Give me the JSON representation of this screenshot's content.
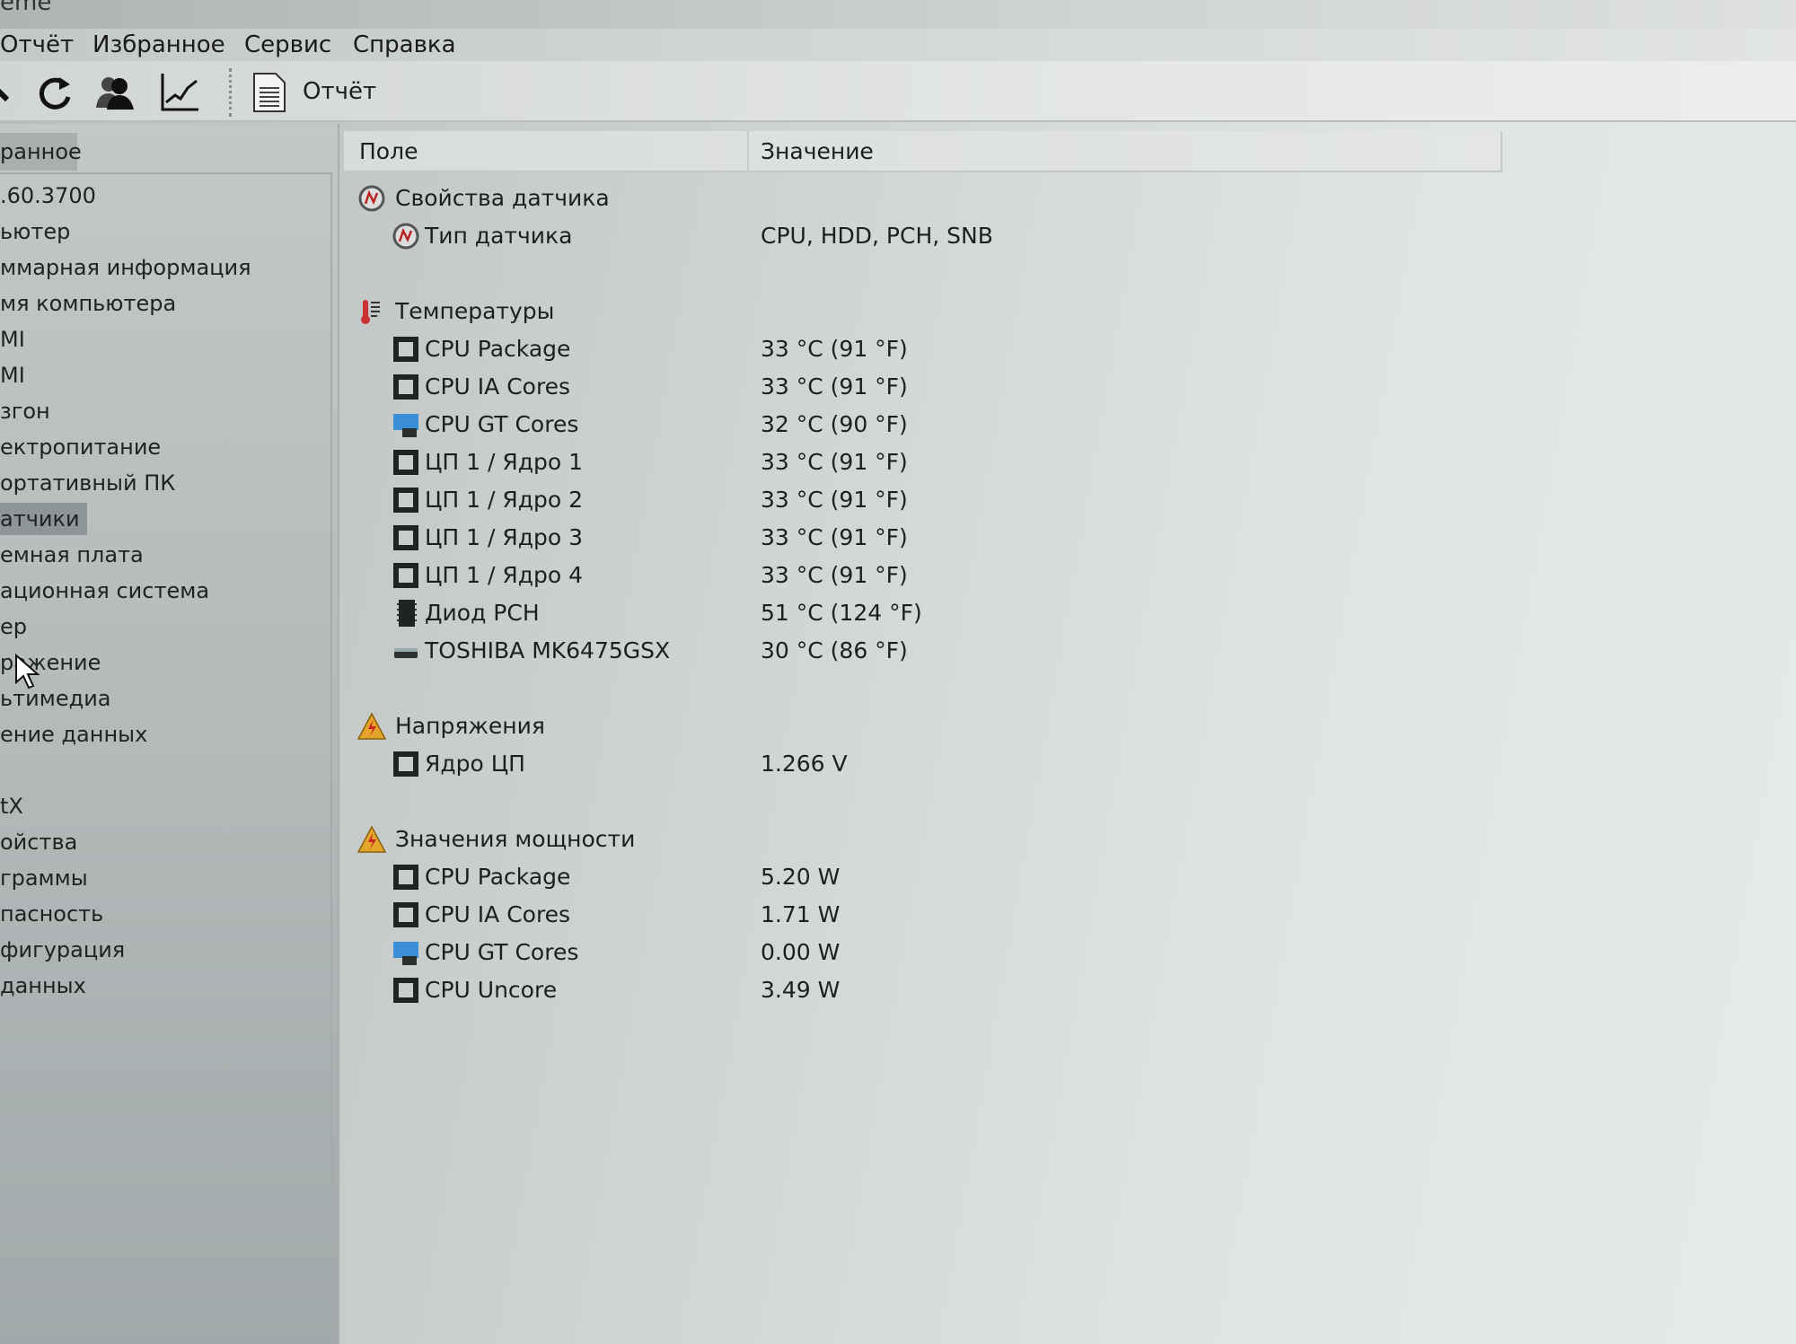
{
  "window": {
    "title_fragment": "eme"
  },
  "menu": [
    "Отчёт",
    "Избранное",
    "Сервис",
    "Справка"
  ],
  "toolbar": {
    "buttons": [
      "back-icon",
      "refresh-icon",
      "users-icon",
      "chart-icon"
    ],
    "report_label": "Отчёт"
  },
  "left_panel": {
    "tab_label": "ранное",
    "items": [
      ".60.3700",
      "ьютер",
      "ммарная информация",
      "мя компьютера",
      "MI",
      "MI",
      "згон",
      "ектропитание",
      "ортативный ПК",
      "атчики",
      "емная плата",
      "ационная система",
      "ер",
      "ражение",
      "ьтимедиа",
      "ение данных",
      "",
      "tX",
      "ойства",
      "граммы",
      "пасность",
      "фигурация",
      "данных"
    ],
    "selected_index": 9
  },
  "columns": {
    "field": "Поле",
    "value": "Значение"
  },
  "rows": [
    {
      "type": "group",
      "icon": "sensor-icon",
      "label": "Свойства датчика",
      "value": ""
    },
    {
      "type": "item",
      "icon": "sensor-icon",
      "label": "Тип датчика",
      "value": "CPU, HDD, PCH, SNB"
    },
    {
      "type": "blank"
    },
    {
      "type": "group",
      "icon": "thermometer-icon",
      "label": "Температуры",
      "value": ""
    },
    {
      "type": "item",
      "icon": "chip-icon",
      "label": "CPU Package",
      "value": "33 °C  (91 °F)"
    },
    {
      "type": "item",
      "icon": "chip-icon",
      "label": "CPU IA Cores",
      "value": "33 °C  (91 °F)"
    },
    {
      "type": "item",
      "icon": "monitor-icon",
      "label": "CPU GT Cores",
      "value": "32 °C  (90 °F)"
    },
    {
      "type": "item",
      "icon": "chip-icon",
      "label": "ЦП 1 / Ядро 1",
      "value": "33 °C  (91 °F)"
    },
    {
      "type": "item",
      "icon": "chip-icon",
      "label": "ЦП 1 / Ядро 2",
      "value": "33 °C  (91 °F)"
    },
    {
      "type": "item",
      "icon": "chip-icon",
      "label": "ЦП 1 / Ядро 3",
      "value": "33 °C  (91 °F)"
    },
    {
      "type": "item",
      "icon": "chip-icon",
      "label": "ЦП 1 / Ядро 4",
      "value": "33 °C  (91 °F)"
    },
    {
      "type": "item",
      "icon": "pch-chip-icon",
      "label": "Диод PCH",
      "value": "51 °C  (124 °F)"
    },
    {
      "type": "item",
      "icon": "hdd-icon",
      "label": "TOSHIBA MK6475GSX",
      "value": "30 °C  (86 °F)"
    },
    {
      "type": "blank"
    },
    {
      "type": "group",
      "icon": "voltage-warning-icon",
      "label": "Напряжения",
      "value": ""
    },
    {
      "type": "item",
      "icon": "chip-icon",
      "label": "Ядро ЦП",
      "value": "1.266 V"
    },
    {
      "type": "blank"
    },
    {
      "type": "group",
      "icon": "voltage-warning-icon",
      "label": "Значения мощности",
      "value": ""
    },
    {
      "type": "item",
      "icon": "chip-icon",
      "label": "CPU Package",
      "value": "5.20 W"
    },
    {
      "type": "item",
      "icon": "chip-icon",
      "label": "CPU IA Cores",
      "value": "1.71 W"
    },
    {
      "type": "item",
      "icon": "monitor-icon",
      "label": "CPU GT Cores",
      "value": "0.00 W"
    },
    {
      "type": "item",
      "icon": "chip-icon",
      "label": "CPU Uncore",
      "value": "3.49 W"
    }
  ]
}
